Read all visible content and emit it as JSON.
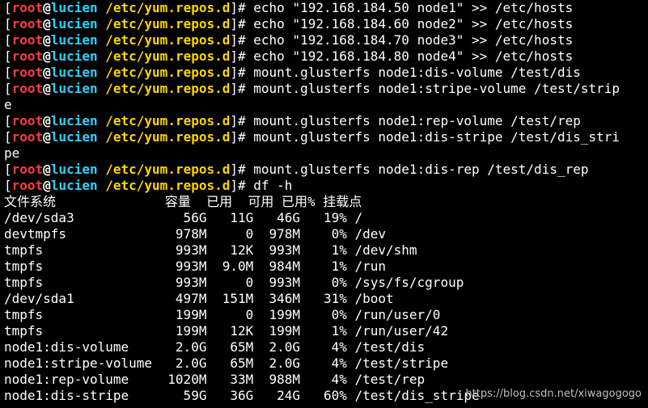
{
  "colors": {
    "background": "#000000",
    "user": "#ff3c3c",
    "host": "#2fd1ff",
    "path": "#ffd400",
    "text": "#ffffff"
  },
  "terminal": {
    "lines": [
      {
        "kind": "prompt",
        "user": "root",
        "host": "lucien",
        "path": "/etc/yum.repos.d",
        "cmd": " echo \"192.168.184.50 node1\" >> /etc/hosts"
      },
      {
        "kind": "prompt",
        "user": "root",
        "host": "lucien",
        "path": "/etc/yum.repos.d",
        "cmd": " echo \"192.168.184.60 node2\" >> /etc/hosts"
      },
      {
        "kind": "prompt",
        "user": "root",
        "host": "lucien",
        "path": "/etc/yum.repos.d",
        "cmd": " echo \"192.168.184.70 node3\" >> /etc/hosts"
      },
      {
        "kind": "prompt",
        "user": "root",
        "host": "lucien",
        "path": "/etc/yum.repos.d",
        "cmd": " echo \"192.168.184.80 node4\" >> /etc/hosts"
      },
      {
        "kind": "prompt",
        "user": "root",
        "host": "lucien",
        "path": "/etc/yum.repos.d",
        "cmd": " mount.glusterfs node1:dis-volume /test/dis"
      },
      {
        "kind": "prompt",
        "user": "root",
        "host": "lucien",
        "path": "/etc/yum.repos.d",
        "cmd": " mount.glusterfs node1:stripe-volume /test/strip"
      },
      {
        "kind": "output",
        "text": "e"
      },
      {
        "kind": "prompt",
        "user": "root",
        "host": "lucien",
        "path": "/etc/yum.repos.d",
        "cmd": " mount.glusterfs node1:rep-volume /test/rep"
      },
      {
        "kind": "prompt",
        "user": "root",
        "host": "lucien",
        "path": "/etc/yum.repos.d",
        "cmd": " mount.glusterfs node1:dis-stripe /test/dis_stri"
      },
      {
        "kind": "output",
        "text": "pe"
      },
      {
        "kind": "prompt",
        "user": "root",
        "host": "lucien",
        "path": "/etc/yum.repos.d",
        "cmd": " mount.glusterfs node1:dis-rep /test/dis_rep"
      },
      {
        "kind": "prompt",
        "user": "root",
        "host": "lucien",
        "path": "/etc/yum.repos.d",
        "cmd": " df -h"
      },
      {
        "kind": "output",
        "text": "文件系统              容量  已用  可用 已用% 挂载点"
      },
      {
        "kind": "output",
        "text": "/dev/sda3              56G   11G   46G   19% /"
      },
      {
        "kind": "output",
        "text": "devtmpfs              978M     0  978M    0% /dev"
      },
      {
        "kind": "output",
        "text": "tmpfs                 993M   12K  993M    1% /dev/shm"
      },
      {
        "kind": "output",
        "text": "tmpfs                 993M  9.0M  984M    1% /run"
      },
      {
        "kind": "output",
        "text": "tmpfs                 993M     0  993M    0% /sys/fs/cgroup"
      },
      {
        "kind": "output",
        "text": "/dev/sda1             497M  151M  346M   31% /boot"
      },
      {
        "kind": "output",
        "text": "tmpfs                 199M     0  199M    0% /run/user/0"
      },
      {
        "kind": "output",
        "text": "tmpfs                 199M   12K  199M    1% /run/user/42"
      },
      {
        "kind": "output",
        "text": "node1:dis-volume      2.0G   65M  2.0G    4% /test/dis"
      },
      {
        "kind": "output",
        "text": "node1:stripe-volume   2.0G   65M  2.0G    4% /test/stripe"
      },
      {
        "kind": "output",
        "text": "node1:rep-volume     1020M   33M  988M    4% /test/rep"
      },
      {
        "kind": "output",
        "text": "node1:dis-stripe       59G   36G   24G   60% /test/dis_stripe"
      }
    ]
  },
  "watermark": "https://blog.csdn.net/xiwagogogo"
}
